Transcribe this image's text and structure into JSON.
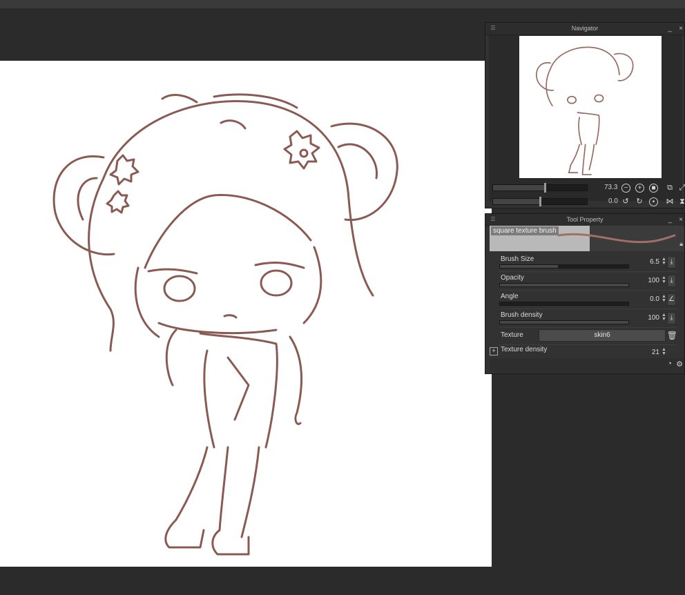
{
  "navigator": {
    "title": "Navigator",
    "zoom_value": "73.3",
    "rotation_value": "0.0",
    "icons": [
      "menu-icon",
      "minimize-icon",
      "close-icon",
      "zoom-out-icon",
      "zoom-in-icon",
      "fit-icon",
      "actual-size-icon",
      "fill-window-icon",
      "rotate-left-icon",
      "rotate-right-icon",
      "reset-rotation-icon",
      "flip-horizontal-icon",
      "flip-vertical-icon"
    ]
  },
  "tool_property": {
    "title": "Tool Property",
    "brush_name": "square texture brush",
    "properties": [
      {
        "label": "Brush Size",
        "value": "6.5",
        "level": 0.45
      },
      {
        "label": "Opacity",
        "value": "100",
        "level": 1.0
      },
      {
        "label": "Angle",
        "value": "0.0",
        "level": 0.0
      },
      {
        "label": "Brush density",
        "value": "100",
        "level": 1.0
      }
    ],
    "texture_label": "Texture",
    "texture_value": "skin6",
    "texture_density_label": "Texture density",
    "texture_density_value": "21"
  },
  "colors": {
    "app_bg": "#2b2b2b",
    "panel_bg": "#323232",
    "canvas_bg": "#ffffff",
    "sketch_stroke": "#8a5a52"
  }
}
